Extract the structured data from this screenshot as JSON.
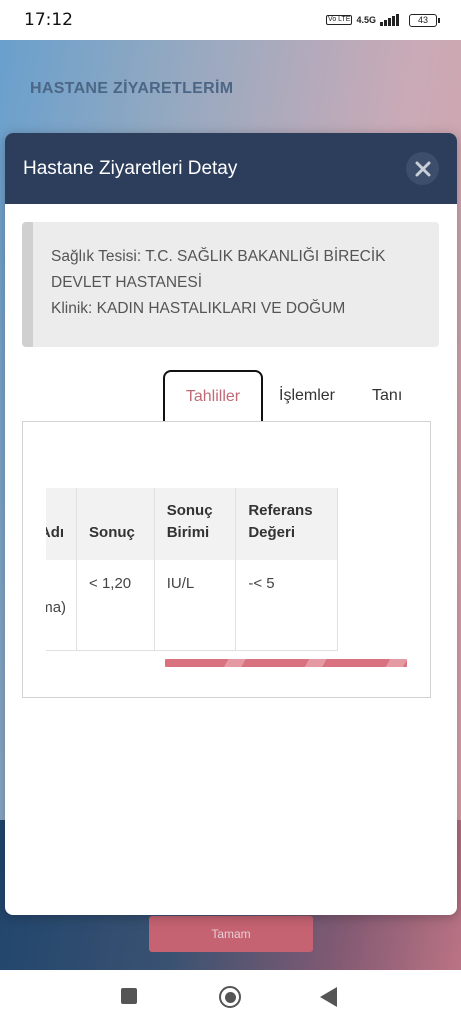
{
  "status_bar": {
    "time": "17:12",
    "volte": "Vo LTE",
    "network": "4.5G",
    "battery": "43"
  },
  "background": {
    "page_title": "HASTANE ZİYARETLERİM",
    "button_label": "Tamam"
  },
  "modal": {
    "title": "Hastane Ziyaretleri Detay",
    "close_icon": "close-icon",
    "facility_line1": "Sağlık Tesisi: T.C. SAĞLIK BAKANLIĞI BİRECİK",
    "facility_line2": "DEVLET HASTANESİ",
    "clinic_line": "Klinik: KADIN HASTALIKLARI VE DOĞUM",
    "tabs": [
      {
        "label": "Tahliller",
        "active": true
      },
      {
        "label": "İşlemler",
        "active": false
      },
      {
        "label": "Tanı",
        "active": false
      }
    ],
    "table": {
      "headers": [
        "Adı",
        "Sonuç",
        "Sonuç Birimi",
        "Referans Değeri"
      ],
      "rows": [
        {
          "name": "G\nPlazma)",
          "result": "< 1,20",
          "unit": "IU/L",
          "reference": "-< 5"
        }
      ]
    }
  },
  "nav": {
    "recents_icon": "square-icon",
    "home_icon": "circle-icon",
    "back_icon": "triangle-back-icon"
  },
  "colors": {
    "header": "#2c3e5c",
    "active_tab_text": "#c06a77",
    "scrollbar": "#d9727f"
  }
}
